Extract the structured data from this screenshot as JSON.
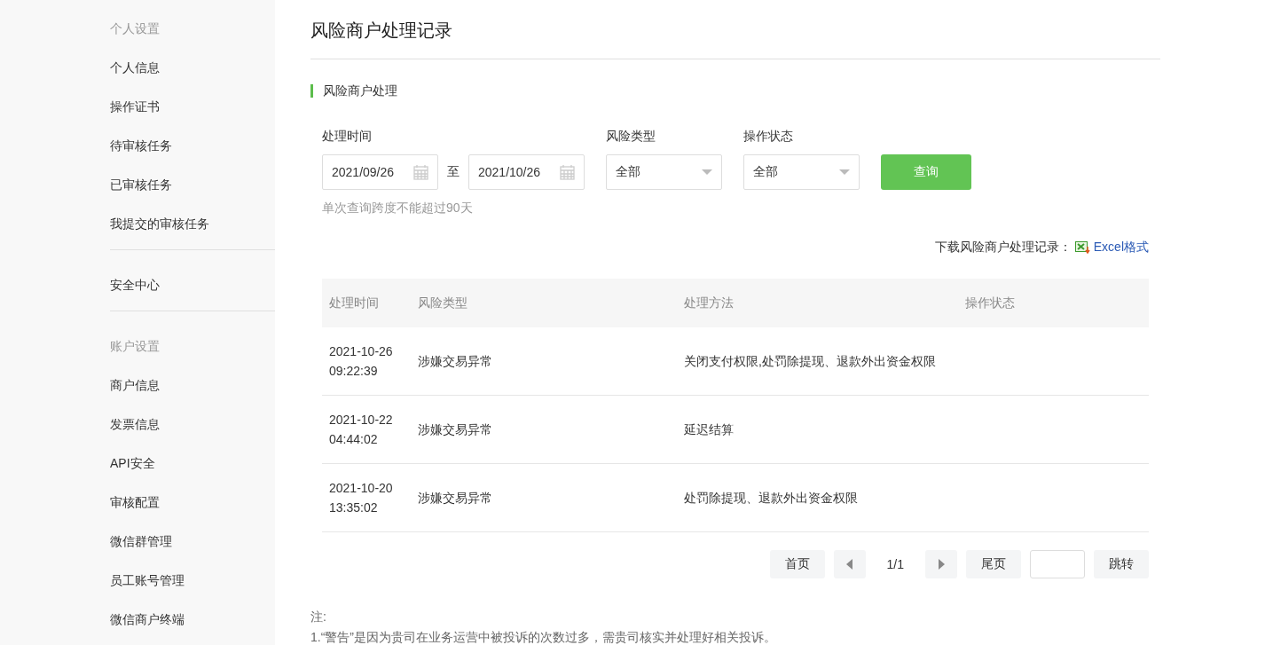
{
  "sidebar": {
    "groups": [
      {
        "title": "个人设置",
        "items": [
          {
            "label": "个人信息",
            "selected": false
          },
          {
            "label": "操作证书",
            "selected": false
          },
          {
            "label": "待审核任务",
            "selected": false
          },
          {
            "label": "已审核任务",
            "selected": false
          },
          {
            "label": "我提交的审核任务",
            "selected": false
          }
        ]
      },
      {
        "items": [
          {
            "label": "安全中心",
            "selected": false
          }
        ]
      },
      {
        "title": "账户设置",
        "items": [
          {
            "label": "商户信息",
            "selected": false
          },
          {
            "label": "发票信息",
            "selected": false
          },
          {
            "label": "API安全",
            "selected": false
          },
          {
            "label": "审核配置",
            "selected": false
          },
          {
            "label": "微信群管理",
            "selected": false
          },
          {
            "label": "员工账号管理",
            "selected": false
          },
          {
            "label": "微信商户终端",
            "selected": false
          }
        ]
      }
    ]
  },
  "page_title": "风险商户处理记录",
  "section_title": "风险商户处理",
  "filters": {
    "time_label": "处理时间",
    "date_from": "2021/09/26",
    "range_sep": "至",
    "date_to": "2021/10/26",
    "type_label": "风险类型",
    "type_value": "全部",
    "status_label": "操作状态",
    "status_value": "全部",
    "query_button": "查询",
    "hint": "单次查询跨度不能超过90天"
  },
  "download": {
    "label": "下载风险商户处理记录：",
    "link": "Excel格式"
  },
  "table": {
    "columns": [
      "处理时间",
      "风险类型",
      "处理方法",
      "操作状态"
    ],
    "rows": [
      {
        "date": "2021-10-26",
        "time": "09:22:39",
        "type": "涉嫌交易异常",
        "method": "关闭支付权限,处罚除提现、退款外出资金权限"
      },
      {
        "date": "2021-10-22",
        "time": "04:44:02",
        "type": "涉嫌交易异常",
        "method": "延迟结算"
      },
      {
        "date": "2021-10-20",
        "time": "13:35:02",
        "type": "涉嫌交易异常",
        "method": "处罚除提现、退款外出资金权限"
      }
    ]
  },
  "pagination": {
    "first": "首页",
    "page": "1/1",
    "last": "尾页",
    "jump": "跳转"
  },
  "notes": [
    "注:",
    "1.“警告”是因为贵司在业务运营中被投诉的次数过多，需贵司核实并处理好相关投诉。"
  ]
}
